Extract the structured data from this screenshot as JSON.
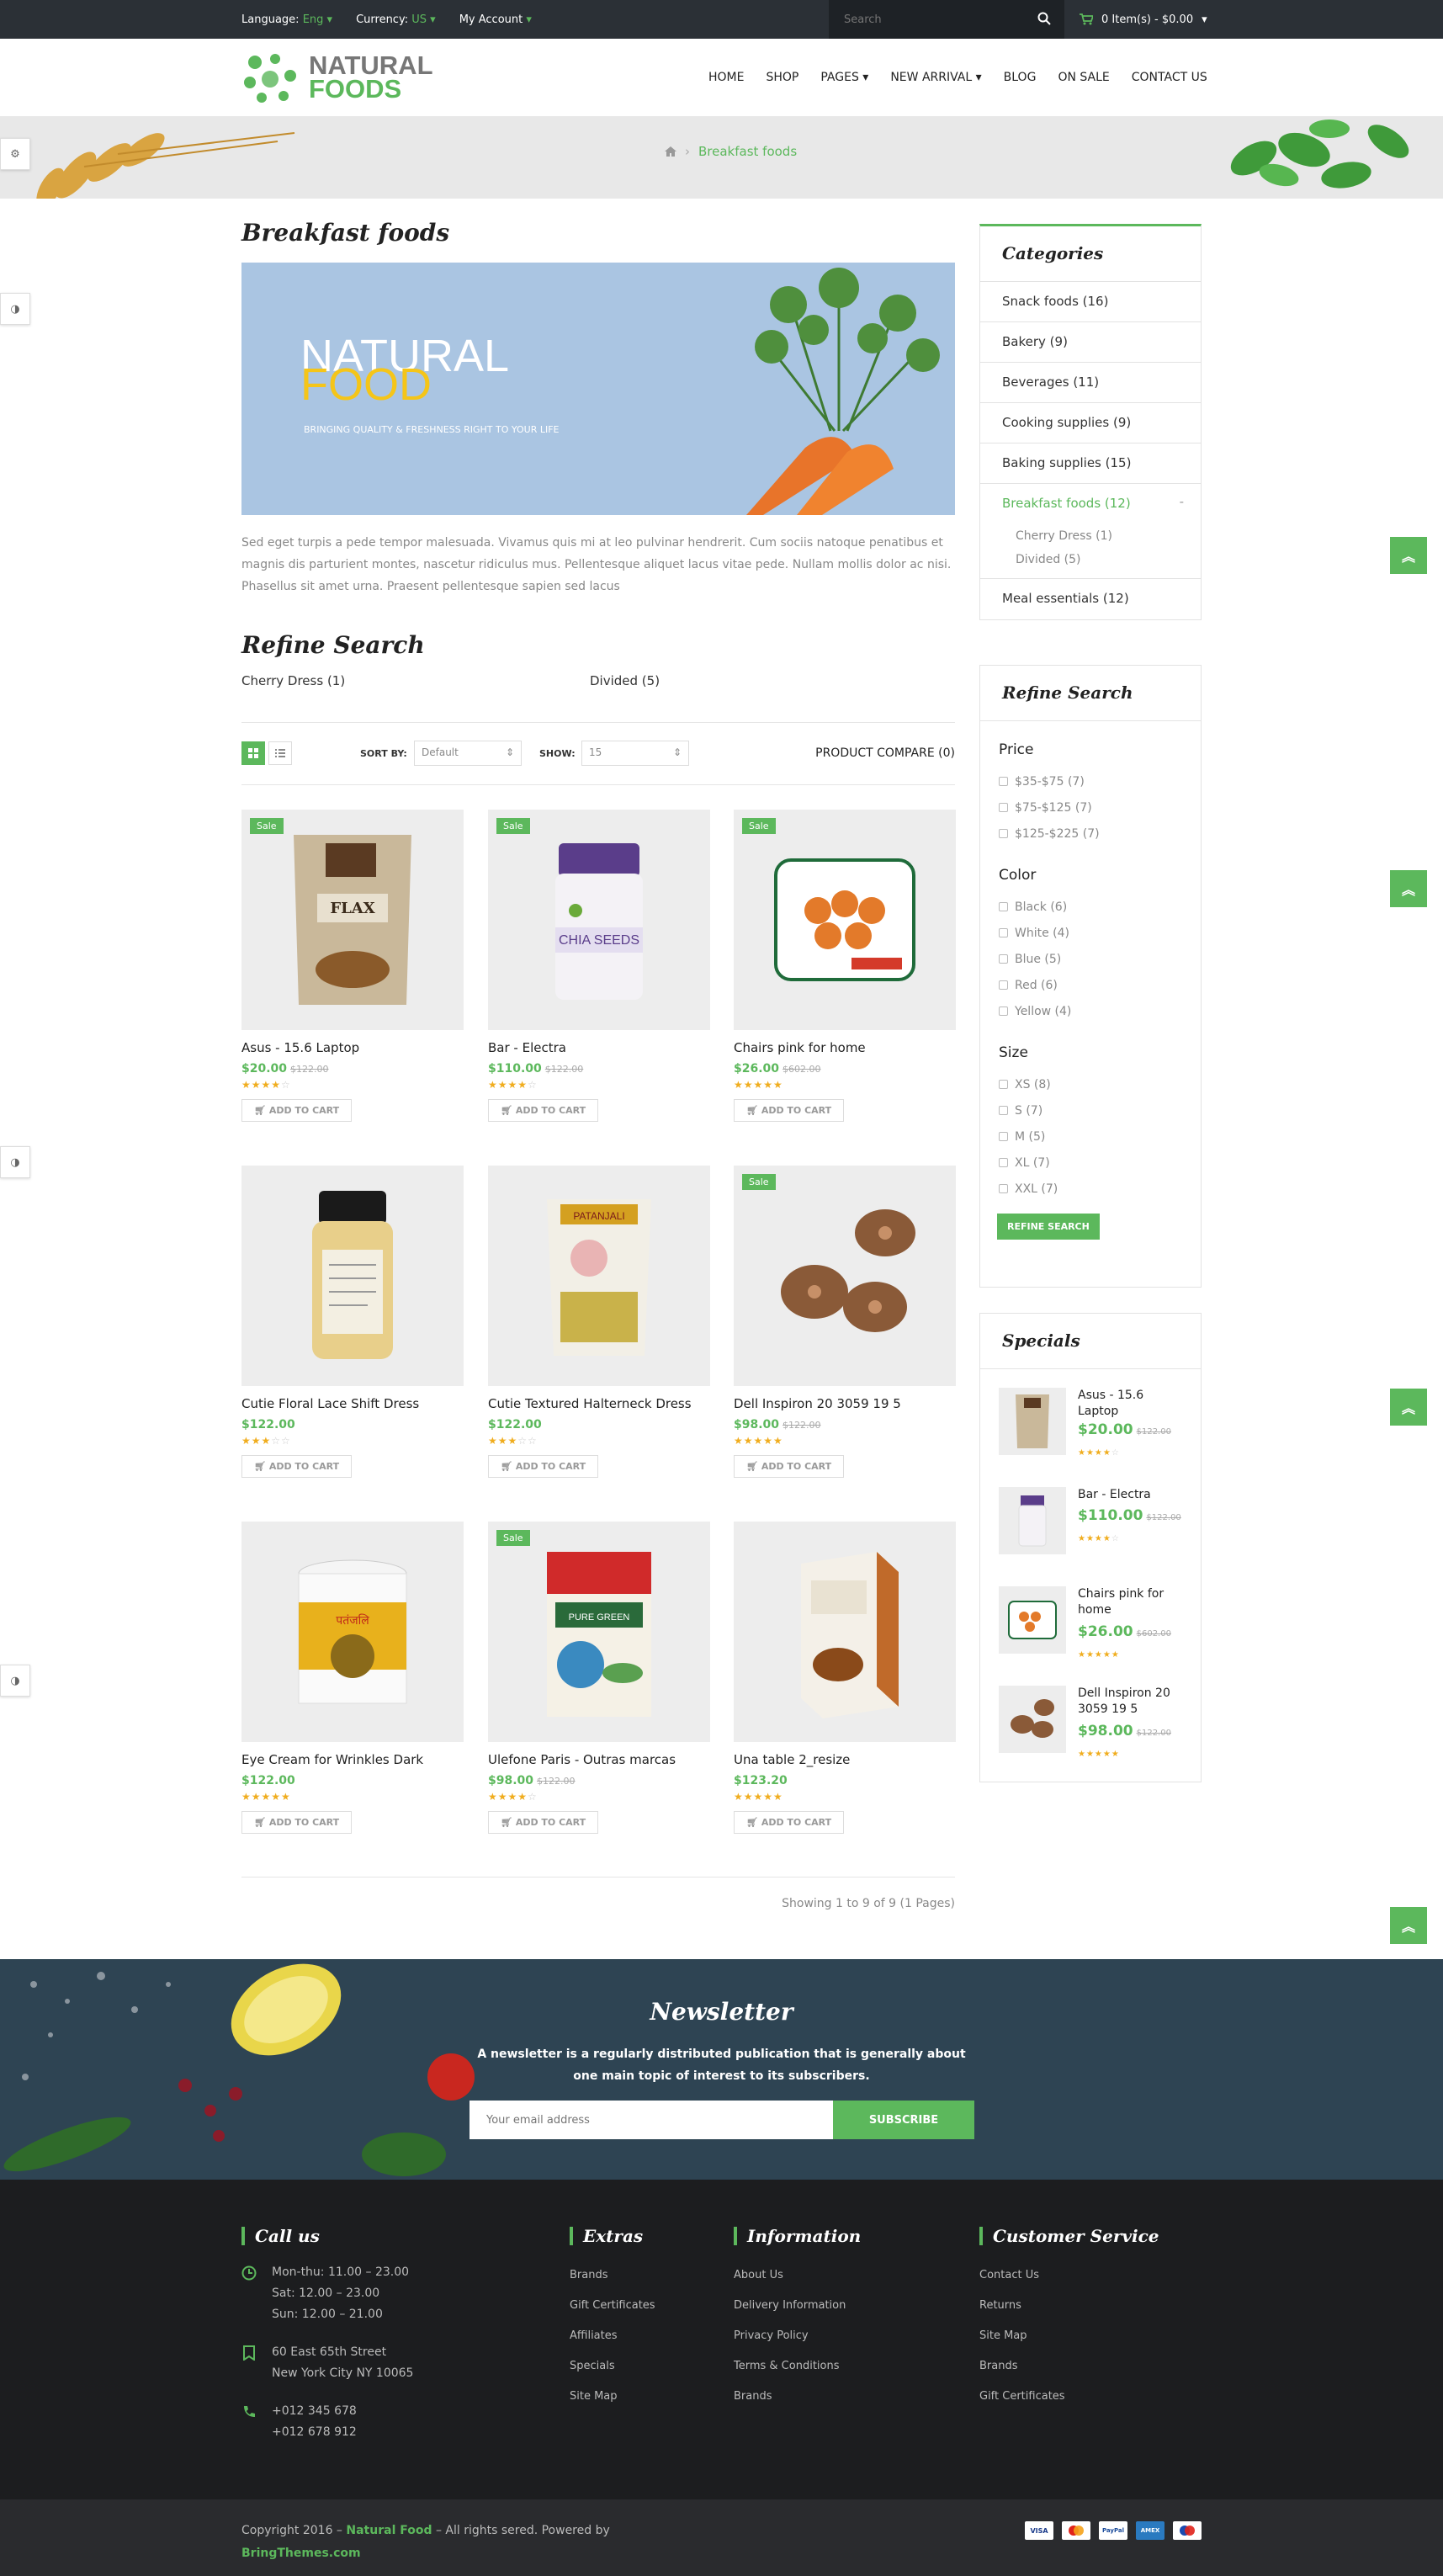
{
  "topbar": {
    "language_label": "Language:",
    "language_value": "Eng",
    "currency_label": "Currency:",
    "currency_value": "US",
    "account": "My Account",
    "search_placeholder": "Search",
    "cart": "0 Item(s) - $0.00"
  },
  "header": {
    "logo_line1": "NATURAL",
    "logo_line2": "FOODS",
    "nav": [
      "HOME",
      "SHOP",
      "PAGES",
      "NEW ARRIVAL",
      "BLOG",
      "ON SALE",
      "CONTACT US"
    ]
  },
  "breadcrumb": {
    "current": "Breakfast foods"
  },
  "main": {
    "title": "Breakfast foods",
    "banner": {
      "line1": "NATURAL",
      "line2": "FOOD",
      "tagline": "BRINGING QUALITY & FRESHNESS RIGHT TO YOUR LIFE"
    },
    "description": "Sed eget turpis a pede tempor malesuada. Vivamus quis mi at leo pulvinar hendrerit. Cum sociis natoque penatibus et magnis dis parturient montes, nascetur ridiculus mus. Pellentesque aliquet lacus vitae pede. Nullam mollis dolor ac nisi. Phasellus sit amet urna. Praesent pellentesque sapien sed lacus",
    "refine_title": "Refine Search",
    "subcategories": [
      "Cherry Dress (1)",
      "Divided (5)"
    ],
    "sort_label": "SORT BY:",
    "sort_value": "Default",
    "show_label": "SHOW:",
    "show_value": "15",
    "compare": "PRODUCT COMPARE (0)",
    "add_to_cart": "ADD TO CART",
    "sale_badge": "Sale",
    "pagination": "Showing 1 to 9 of 9 (1 Pages)"
  },
  "products": [
    {
      "name": "Asus - 15.6 Laptop",
      "price": "$20.00",
      "old": "$122.00",
      "rating": 4,
      "sale": true
    },
    {
      "name": "Bar - Electra",
      "price": "$110.00",
      "old": "$122.00",
      "rating": 4,
      "sale": true
    },
    {
      "name": "Chairs pink for home",
      "price": "$26.00",
      "old": "$602.00",
      "rating": 5,
      "sale": true
    },
    {
      "name": "Cutie Floral Lace Shift Dress",
      "price": "$122.00",
      "old": "",
      "rating": 3,
      "sale": false
    },
    {
      "name": "Cutie Textured Halterneck Dress",
      "price": "$122.00",
      "old": "",
      "rating": 3,
      "sale": false
    },
    {
      "name": "Dell Inspiron 20 3059 19 5",
      "price": "$98.00",
      "old": "$122.00",
      "rating": 5,
      "sale": true
    },
    {
      "name": "Eye Cream for Wrinkles Dark",
      "price": "$122.00",
      "old": "",
      "rating": 5,
      "sale": false
    },
    {
      "name": "Ulefone Paris - Outras marcas",
      "price": "$98.00",
      "old": "$122.00",
      "rating": 4,
      "sale": true
    },
    {
      "name": "Una table 2_resize",
      "price": "$123.20",
      "old": "",
      "rating": 5,
      "sale": false
    }
  ],
  "sidebar": {
    "categories_title": "Categories",
    "categories": [
      "Snack foods (16)",
      "Bakery (9)",
      "Beverages (11)",
      "Cooking supplies (9)",
      "Baking supplies (15)",
      "Breakfast foods (12)"
    ],
    "active_subcats": [
      "Cherry Dress (1)",
      "Divided (5)"
    ],
    "last_category": "Meal essentials (12)",
    "collapse_symbol": "-",
    "refine_title": "Refine Search",
    "price_title": "Price",
    "price": [
      "$35-$75 (7)",
      "$75-$125 (7)",
      "$125-$225 (7)"
    ],
    "color_title": "Color",
    "color": [
      "Black (6)",
      "White (4)",
      "Blue (5)",
      "Red (6)",
      "Yellow (4)"
    ],
    "size_title": "Size",
    "size": [
      "XS (8)",
      "S (7)",
      "M (5)",
      "XL (7)",
      "XXL (7)"
    ],
    "refine_button": "REFINE SEARCH",
    "specials_title": "Specials",
    "specials": [
      {
        "name": "Asus - 15.6 Laptop",
        "price": "$20.00",
        "old": "$122.00"
      },
      {
        "name": "Bar - Electra",
        "price": "$110.00",
        "old": "$122.00"
      },
      {
        "name": "Chairs pink for home",
        "price": "$26.00",
        "old": "$602.00"
      },
      {
        "name": "Dell Inspiron 20 3059 19 5",
        "price": "$98.00",
        "old": "$122.00"
      }
    ]
  },
  "newsletter": {
    "title": "Newsletter",
    "description": "A newsletter is a regularly distributed publication that is generally about one main topic of interest to its subscribers.",
    "placeholder": "Your email address",
    "button": "SUBSCRIBE"
  },
  "footer": {
    "call_title": "Call us",
    "hours": [
      "Mon-thu: 11.00 – 23.00",
      "Sat: 12.00 – 23.00",
      "Sun: 12.00 – 21.00"
    ],
    "address": [
      "60 East 65th Street",
      "New York City NY 10065"
    ],
    "phones": [
      "+012 345 678",
      "+012 678 912"
    ],
    "extras_title": "Extras",
    "extras": [
      "Brands",
      "Gift Certificates",
      "Affiliates",
      "Specials",
      "Site Map"
    ],
    "info_title": "Information",
    "info": [
      "About Us",
      "Delivery Information",
      "Privacy Policy",
      "Terms & Conditions",
      "Brands"
    ],
    "service_title": "Customer Service",
    "service": [
      "Contact Us",
      "Returns",
      "Site Map",
      "Brands",
      "Gift Certificates"
    ],
    "copyright_pre": "Copyright 2016 –",
    "brand": "Natural Food",
    "copyright_mid": "– All rights sered. Powered by",
    "powered": "BringThemes.com",
    "payments": [
      "VISA",
      "MC",
      "PayPal",
      "AMEX",
      "MC"
    ]
  },
  "colors": {
    "accent": "#5cb85c",
    "dark": "#2b3036",
    "footer": "#1c1d1f",
    "star": "#f0ad1e"
  }
}
